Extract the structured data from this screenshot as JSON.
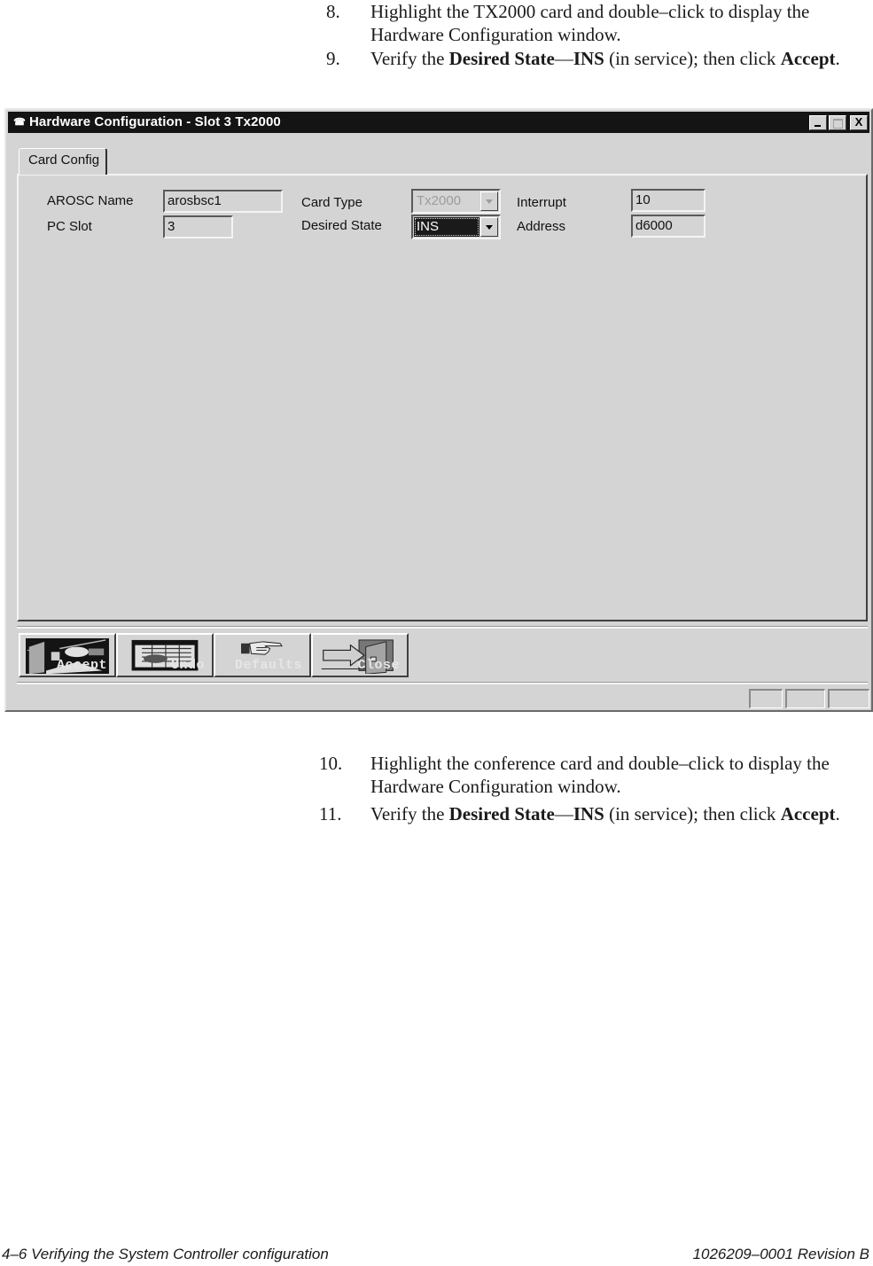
{
  "steps_top": [
    {
      "num": "8.",
      "parts": [
        {
          "t": "Highlight the TX2000 card and double–click to display the Hardware Configuration window.",
          "b": false
        }
      ]
    },
    {
      "num": "9.",
      "parts": [
        {
          "t": "Verify the ",
          "b": false
        },
        {
          "t": "Desired State",
          "b": true
        },
        {
          "t": "—",
          "b": false
        },
        {
          "t": "INS",
          "b": true
        },
        {
          "t": " (in service); then click ",
          "b": false
        },
        {
          "t": "Accept",
          "b": true
        },
        {
          "t": ".",
          "b": false
        }
      ]
    }
  ],
  "steps_bottom": [
    {
      "num": "10.",
      "parts": [
        {
          "t": "Highlight the conference card and double–click to display the Hardware Configuration window.",
          "b": false
        }
      ]
    },
    {
      "num": "11.",
      "parts": [
        {
          "t": "Verify the ",
          "b": false
        },
        {
          "t": "Desired State",
          "b": true
        },
        {
          "t": "—",
          "b": false
        },
        {
          "t": "INS",
          "b": true
        },
        {
          "t": " (in service); then click ",
          "b": false
        },
        {
          "t": "Accept",
          "b": true
        },
        {
          "t": ".",
          "b": false
        }
      ]
    }
  ],
  "window": {
    "title": "Hardware Configuration - Slot 3 Tx2000",
    "app_icon": "phone-icon",
    "controls": {
      "minimize": "minimize-icon",
      "maximize": "maximize-icon",
      "close": "X"
    },
    "tab": "Card Config",
    "fields": {
      "arosc_name": {
        "label": "AROSC Name",
        "value": "arosbsc1"
      },
      "pc_slot": {
        "label": "PC Slot",
        "value": "3"
      },
      "card_type": {
        "label": "Card Type",
        "value": "Tx2000",
        "disabled": true
      },
      "desired_state": {
        "label": "Desired State",
        "value": "INS"
      },
      "interrupt": {
        "label": "Interrupt",
        "value": "10"
      },
      "address": {
        "label": "Address",
        "value": "d6000"
      }
    },
    "toolbar": [
      {
        "label": "Accept",
        "icon": "accept-icon"
      },
      {
        "label": "Undo",
        "icon": "undo-icon"
      },
      {
        "label": "Defaults",
        "icon": "pointing-hand-icon"
      },
      {
        "label": "Close",
        "icon": "exit-door-icon"
      }
    ],
    "status_panes": [
      "",
      "",
      ""
    ]
  },
  "footer": {
    "left": "4–6  Verifying the System Controller configuration",
    "right": "1026209–0001  Revision B"
  }
}
